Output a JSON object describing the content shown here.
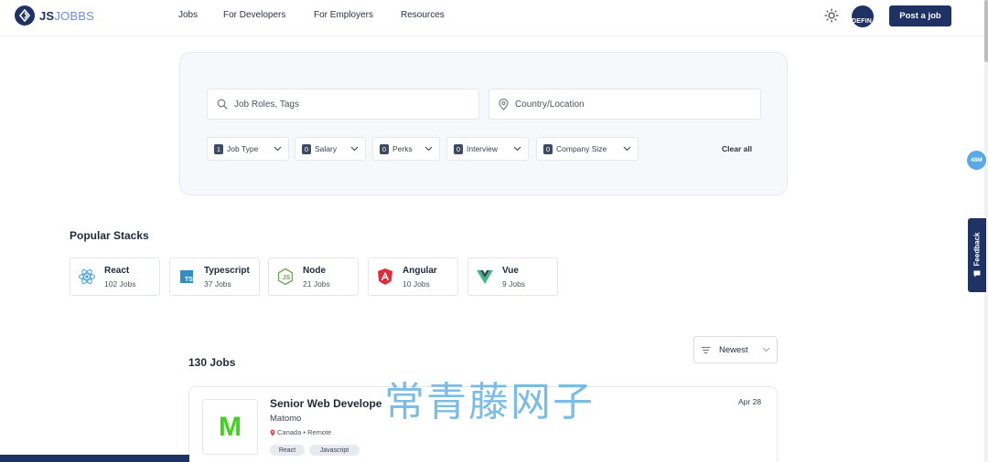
{
  "header": {
    "logo_prefix": "JS",
    "logo_suffix": "JOBBS",
    "nav": {
      "jobs": "Jobs",
      "developers": "For Developers",
      "employers": "For Employers",
      "resources": "Resources"
    },
    "avatar_text": "DEFIN",
    "post_job": "Post a job"
  },
  "search": {
    "roles_placeholder": "Job Roles, Tags",
    "location_placeholder": "Country/Location",
    "filters": [
      {
        "count": "1",
        "label": "Job Type"
      },
      {
        "count": "0",
        "label": "Salary"
      },
      {
        "count": "0",
        "label": "Perks"
      },
      {
        "count": "0",
        "label": "Interview"
      },
      {
        "count": "0",
        "label": "Company Size"
      }
    ],
    "clear_all": "Clear all"
  },
  "side": {
    "badge": "48M",
    "feedback": "Feedback"
  },
  "stacks": {
    "title": "Popular Stacks",
    "items": [
      {
        "name": "React",
        "jobs": "102 Jobs",
        "icon": "react-icon"
      },
      {
        "name": "Typescript",
        "jobs": "37 Jobs",
        "icon": "typescript-icon"
      },
      {
        "name": "Node",
        "jobs": "21 Jobs",
        "icon": "node-icon"
      },
      {
        "name": "Angular",
        "jobs": "10 Jobs",
        "icon": "angular-icon"
      },
      {
        "name": "Vue",
        "jobs": "9 Jobs",
        "icon": "vue-icon"
      }
    ]
  },
  "jobs": {
    "count": "130 Jobs",
    "sort": "Newest",
    "list": [
      {
        "logo_letter": "M",
        "title": "Senior Web Develope",
        "company": "Matomo",
        "location": "Canada • Remote",
        "tags": [
          "React",
          "Javascript"
        ],
        "date": "Apr 28"
      }
    ]
  },
  "watermark": "常青藤网子",
  "colors": {
    "brand": "#1e3264",
    "accent": "#5aa9e6",
    "logo_green": "#3fd21f"
  }
}
